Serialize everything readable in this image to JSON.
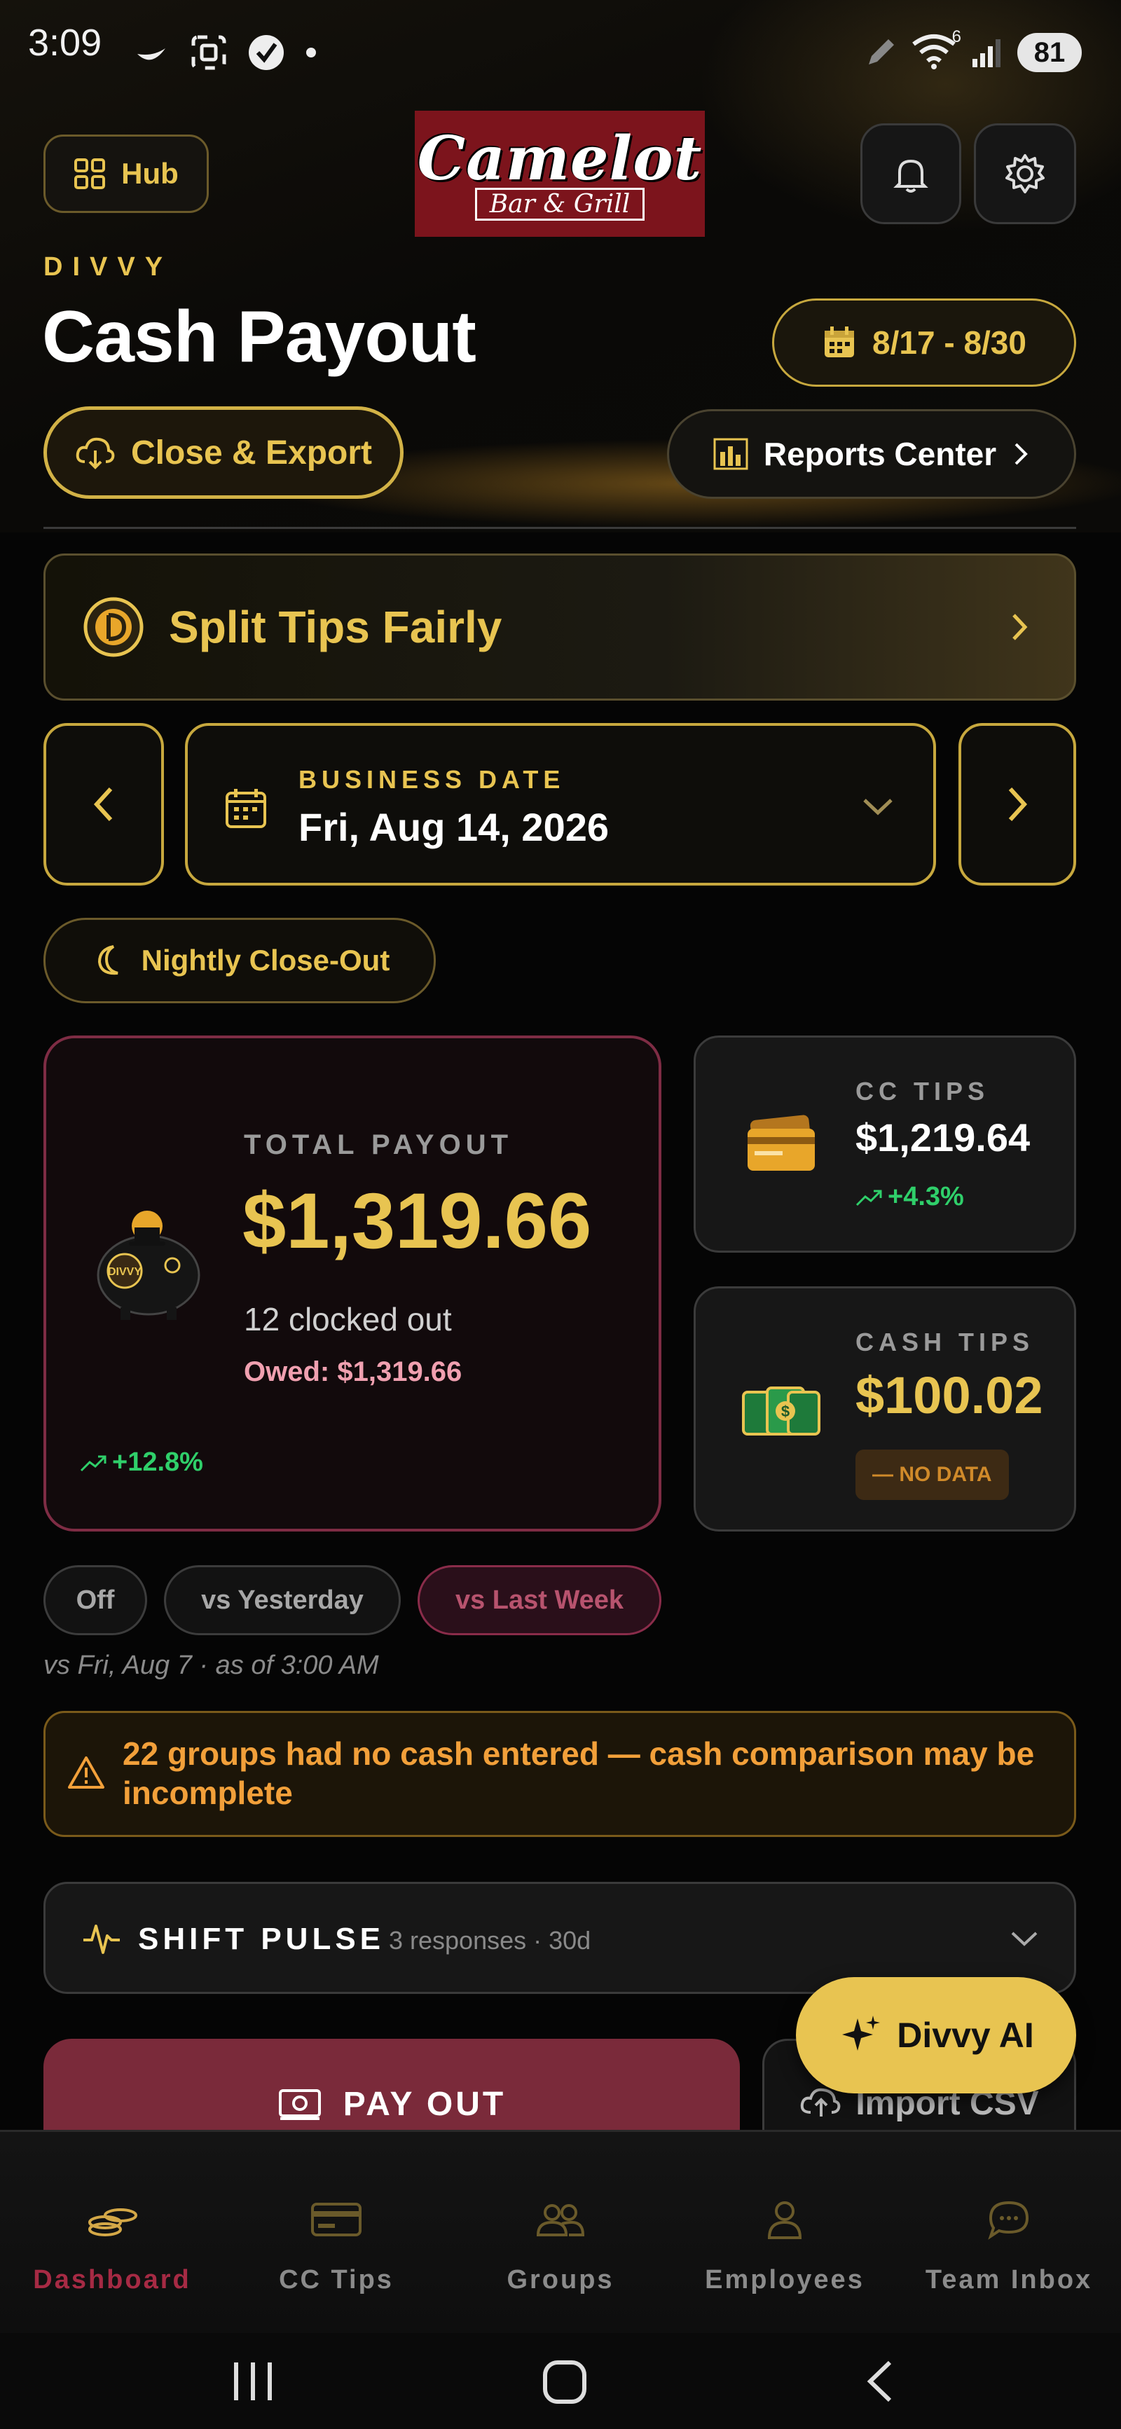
{
  "status_bar": {
    "time": "3:09",
    "battery": "81",
    "wifi_badge": "6"
  },
  "header": {
    "hub_label": "Hub",
    "brand_main": "Camelot",
    "brand_sub": "Bar & Grill",
    "eyebrow": "DIVVY",
    "title": "Cash Payout",
    "date_range": "8/17 - 8/30",
    "close_export_label": "Close & Export",
    "reports_label": "Reports Center"
  },
  "promo": {
    "label": "Split Tips Fairly"
  },
  "business_date": {
    "caption": "BUSINESS DATE",
    "value": "Fri, Aug 14, 2026"
  },
  "nightly_label": "Nightly Close-Out",
  "total_payout": {
    "caption": "TOTAL PAYOUT",
    "amount": "$1,319.66",
    "clocked_out": "12 clocked out",
    "owed": "Owed: $1,319.66",
    "trend": "+12.8%"
  },
  "cc_tips": {
    "caption": "CC TIPS",
    "amount": "$1,219.64",
    "trend": "+4.3%"
  },
  "cash_tips": {
    "caption": "CASH TIPS",
    "amount": "$100.02",
    "badge": "— NO DATA"
  },
  "compare": {
    "options": [
      "Off",
      "vs Yesterday",
      "vs Last Week"
    ],
    "selected": "vs Last Week",
    "note": "vs Fri, Aug 7 · as of 3:00 AM"
  },
  "warning": {
    "text": "22 groups had no cash entered — cash comparison may be incomplete"
  },
  "shift_pulse": {
    "title": "SHIFT PULSE",
    "meta": "3 responses · 30d"
  },
  "actions": {
    "payout_label": "PAY OUT",
    "import_label": "Import CSV",
    "ai_label": "Divvy AI"
  },
  "bottom_nav": {
    "items": [
      "Dashboard",
      "CC Tips",
      "Groups",
      "Employees",
      "Team Inbox"
    ],
    "active": "Dashboard"
  },
  "colors": {
    "accent_gold": "#e8c451",
    "payout_red": "#7a2a3a",
    "positive_green": "#2fcf6a",
    "warning_orange": "#f2a03a"
  }
}
